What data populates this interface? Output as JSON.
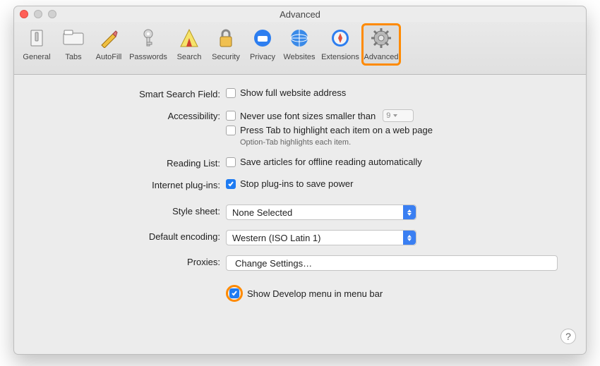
{
  "window": {
    "title": "Advanced"
  },
  "toolbar": {
    "items": [
      {
        "id": "general",
        "label": "General"
      },
      {
        "id": "tabs",
        "label": "Tabs"
      },
      {
        "id": "autofill",
        "label": "AutoFill"
      },
      {
        "id": "passwords",
        "label": "Passwords"
      },
      {
        "id": "search",
        "label": "Search"
      },
      {
        "id": "security",
        "label": "Security"
      },
      {
        "id": "privacy",
        "label": "Privacy"
      },
      {
        "id": "websites",
        "label": "Websites"
      },
      {
        "id": "extensions",
        "label": "Extensions"
      },
      {
        "id": "advanced",
        "label": "Advanced",
        "active": true
      }
    ]
  },
  "sections": {
    "smart_search": {
      "label": "Smart Search Field:",
      "show_full_address": {
        "checked": false,
        "text": "Show full website address"
      }
    },
    "accessibility": {
      "label": "Accessibility:",
      "min_font": {
        "checked": false,
        "text": "Never use font sizes smaller than",
        "value": "9"
      },
      "press_tab": {
        "checked": false,
        "text": "Press Tab to highlight each item on a web page"
      },
      "hint": "Option-Tab highlights each item."
    },
    "reading_list": {
      "label": "Reading List:",
      "save_offline": {
        "checked": false,
        "text": "Save articles for offline reading automatically"
      }
    },
    "plugins": {
      "label": "Internet plug-ins:",
      "stop_power": {
        "checked": true,
        "text": "Stop plug-ins to save power"
      }
    },
    "style_sheet": {
      "label": "Style sheet:",
      "value": "None Selected"
    },
    "encoding": {
      "label": "Default encoding:",
      "value": "Western (ISO Latin 1)"
    },
    "proxies": {
      "label": "Proxies:",
      "button": "Change Settings…"
    },
    "develop": {
      "checked": true,
      "text": "Show Develop menu in menu bar"
    }
  },
  "help_button": "?"
}
